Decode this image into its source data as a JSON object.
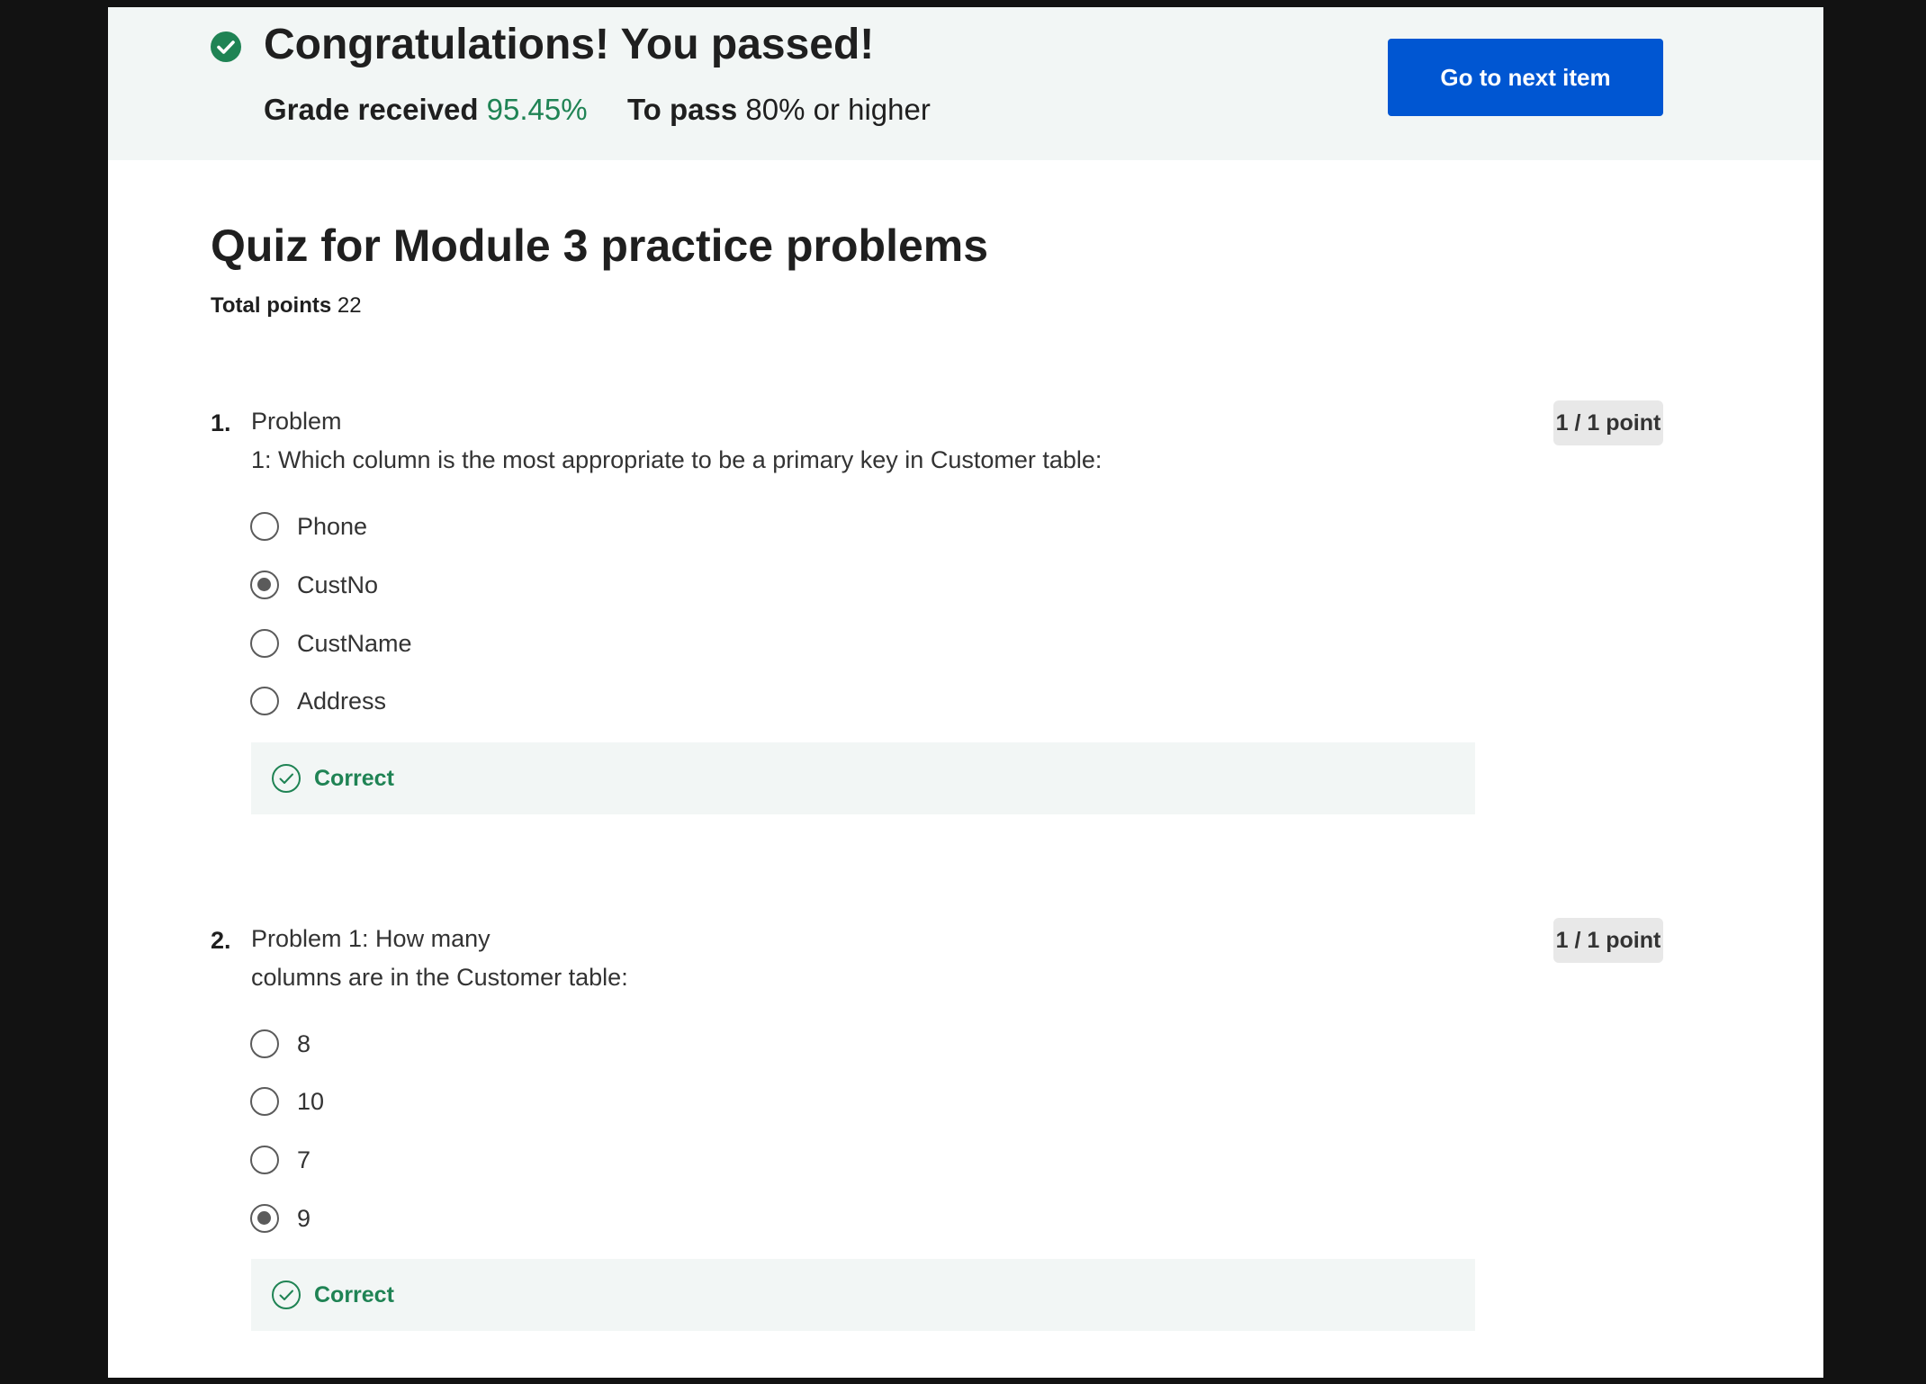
{
  "banner": {
    "title": "Congratulations! You passed!",
    "grade_label": "Grade received",
    "grade_value": "95.45%",
    "pass_label": "To pass",
    "pass_value": "80% or higher",
    "next_button": "Go to next item",
    "icon": "check-circle-icon",
    "accent_color": "#1f8354",
    "button_color": "#0056d2"
  },
  "quiz": {
    "title": "Quiz for Module 3 practice problems",
    "total_points_label": "Total points",
    "total_points_value": "22"
  },
  "questions": [
    {
      "number": "1.",
      "text_line1": "Problem",
      "text_line2": "1: Which column is the most appropriate to be a primary key in Customer table:",
      "points": "1 / 1 point",
      "options": [
        {
          "label": "Phone",
          "selected": false
        },
        {
          "label": "CustNo",
          "selected": true
        },
        {
          "label": "CustName",
          "selected": false
        },
        {
          "label": "Address",
          "selected": false
        }
      ],
      "feedback": "Correct"
    },
    {
      "number": "2.",
      "text_line1": "Problem 1: How many",
      "text_line2": "columns are in the Customer table:",
      "points": "1 / 1 point",
      "options": [
        {
          "label": "8",
          "selected": false
        },
        {
          "label": "10",
          "selected": false
        },
        {
          "label": "7",
          "selected": false
        },
        {
          "label": "9",
          "selected": true
        }
      ],
      "feedback": "Correct"
    }
  ]
}
